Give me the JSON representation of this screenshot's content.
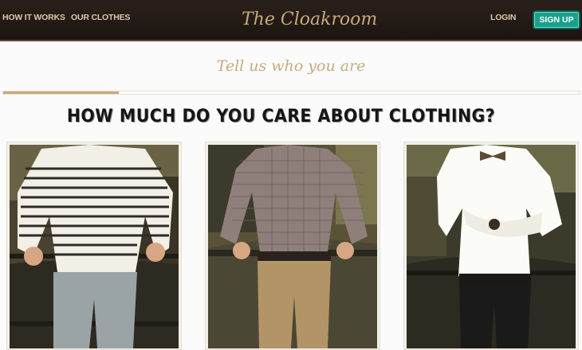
{
  "header": {
    "nav": [
      {
        "label": "HOW IT WORKS"
      },
      {
        "label": "OUR CLOTHES"
      }
    ],
    "logo_text": "The Cloakroom",
    "login_label": "LOGIN",
    "signup_label": "SIGN UP"
  },
  "step": {
    "tagline": "Tell us who you are",
    "progress": 0.2
  },
  "question": "HOW MUCH DO YOU CARE ABOUT CLOTHING?",
  "options": [
    {
      "style": "striped sweater, light jeans"
    },
    {
      "style": "checked shirt, khaki chinos"
    },
    {
      "style": "white shirt, bow tie, dark jeans"
    }
  ]
}
